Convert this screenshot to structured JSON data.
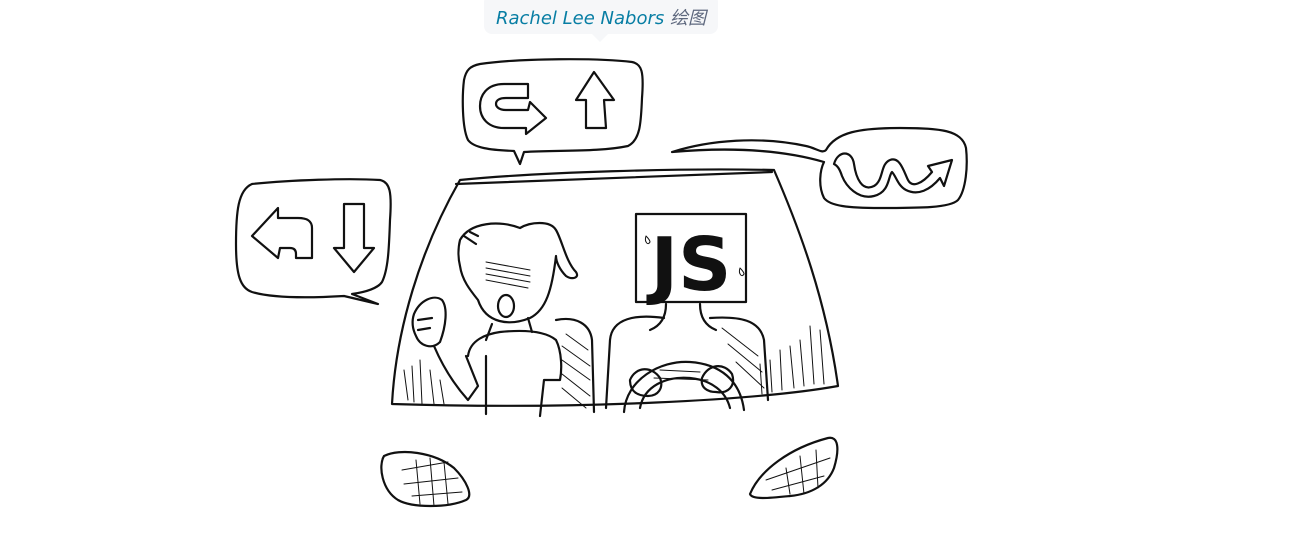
{
  "caption": {
    "author": "Rachel Lee Nabors",
    "suffix": "绘图"
  },
  "illustration": {
    "sign_text": "JS",
    "icons": [
      "turn-left-arrow-icon",
      "down-arrow-icon",
      "u-turn-arrow-icon",
      "up-arrow-icon",
      "wavy-arrow-icon"
    ]
  }
}
